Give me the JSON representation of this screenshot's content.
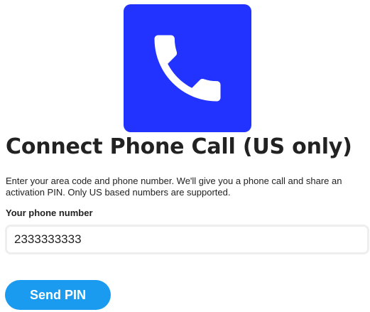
{
  "app_icon": {
    "name": "phone-icon",
    "background_color": "#2233ff",
    "glyph_color": "#ffffff"
  },
  "title": "Connect Phone Call (US only)",
  "description": "Enter your area code and phone number. We'll give you a phone call and share an activation PIN. Only US based numbers are supported.",
  "phone_field": {
    "label": "Your phone number",
    "value": "2333333333"
  },
  "send_button": {
    "label": "Send PIN",
    "color": "#1a9bf0"
  }
}
